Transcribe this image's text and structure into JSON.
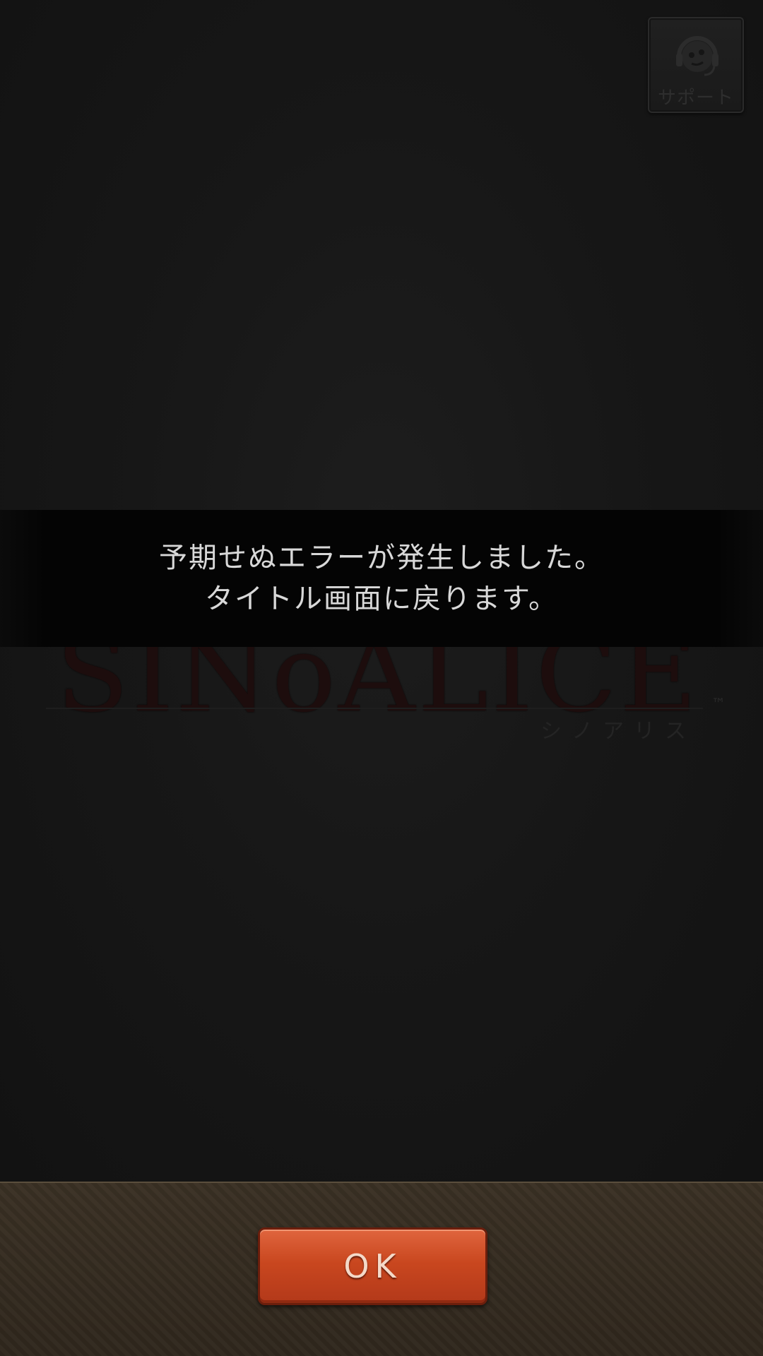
{
  "support": {
    "label": "サポート",
    "icon": "headset-face-icon"
  },
  "logo": {
    "title": "SINoALICE",
    "kana": "シノアリス",
    "trademark": "™"
  },
  "dialog": {
    "line1": "予期せぬエラーが発生しました。",
    "line2": "タイトル画面に戻ります。"
  },
  "footer": {
    "ok_label": "OK"
  },
  "colors": {
    "background": "#161616",
    "banner": "#040404",
    "footer": "#352c21",
    "ok_button": "#c9471f",
    "text": "#d8d8d8"
  }
}
